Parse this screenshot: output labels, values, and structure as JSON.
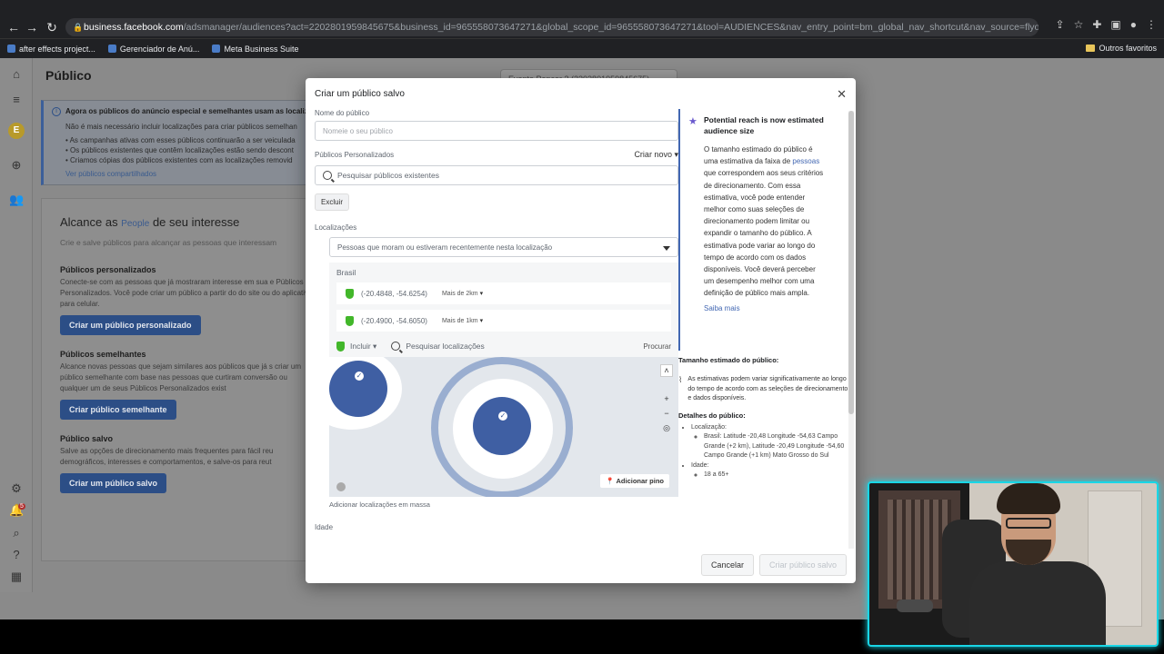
{
  "browser": {
    "url_host": "business.facebook.com",
    "url_rest": "/adsmanager/audiences?act=2202801959845675&business_id=965558073647271&global_scope_id=965558073647271&tool=AUDIENCES&nav_entry_point=bm_global_nav_shortcut&nav_source=flyout_menu&nav_id=2775930...",
    "bookmarks": [
      "after effects project...",
      "Gerenciador de Anú...",
      "Meta Business Suite"
    ],
    "bookmarks_right": "Outros favoritos"
  },
  "page": {
    "title": "Público",
    "account_select": "Evento Popcor 3 (2202801959845675)",
    "notice": {
      "title": "Agora os públicos do anúncio especial e semelhantes usam as localiz",
      "line1": "Não é mais necessário incluir localizações para criar públicos semelhan",
      "bullet1": "• As campanhas ativas com esses públicos continuarão a ser veiculada",
      "bullet2": "• Os públicos existentes que contêm localizações estão sendo descont",
      "bullet3": "• Criamos cópias dos públicos existentes com as localizações removid",
      "link": "Ver públicos compartilhados"
    },
    "card": {
      "heading_a": "Alcance as ",
      "heading_people": "People",
      "heading_b": " de seu interesse",
      "sub": "Crie e salve públicos para alcançar as pessoas que interessam",
      "sections": [
        {
          "title": "Públicos personalizados",
          "text": "Conecte-se com as pessoas que já mostraram interesse em sua e Públicos Personalizados. Você pode criar um público a partir do do site ou do aplicativo para celular.",
          "button": "Criar um público personalizado"
        },
        {
          "title": "Públicos semelhantes",
          "text": "Alcance novas pessoas que sejam similares aos públicos que já s criar um público semelhante com base nas pessoas que curtiram conversão ou qualquer um de seus Públicos Personalizados exist",
          "button": "Criar público semelhante"
        },
        {
          "title": "Público salvo",
          "text": "Salve as opções de direcionamento mais frequentes para fácil reu demográficos, interesses e comportamentos, e salve-os para reut",
          "button": "Criar um público salvo"
        }
      ]
    }
  },
  "modal": {
    "title": "Criar um público salvo",
    "name_label": "Nome do público",
    "name_placeholder": "Nomeie o seu público",
    "custom_label": "Públicos Personalizados",
    "create_new": "Criar novo",
    "search_placeholder": "Pesquisar públicos existentes",
    "exclude_btn": "Excluir",
    "locations_label": "Localizações",
    "locations_dropdown": "Pessoas que moram ou estiveram recentemente nesta localização",
    "country": "Brasil",
    "locations": [
      {
        "coords": "(-20.4848, -54.6254)",
        "radius": "Mais de 2km"
      },
      {
        "coords": "(-20.4900, -54.6050)",
        "radius": "Mais de 1km"
      }
    ],
    "include": "Incluir",
    "search_locations": "Pesquisar localizações",
    "search_btn": "Procurar",
    "add_pin": "Adicionar pino",
    "bulk_link": "Adicionar localizações em massa",
    "age_label": "Idade",
    "cancel": "Cancelar",
    "submit": "Criar público salvo"
  },
  "sidebar_info": {
    "title": "Potential reach is now estimated audience size",
    "text_a": "O tamanho estimado do público é uma estimativa da faixa de ",
    "text_link": "pessoas",
    "text_b": " que correspondem aos seus critérios de direcionamento. Com essa estimativa, você pode entender melhor como suas seleções de direcionamento podem limitar ou expandir o tamanho do público. A estimativa pode variar ao longo do tempo de acordo com os dados disponíveis. Você deverá perceber um desempenho melhor com uma definição de público mais ampla.",
    "learn_more": "Saiba mais",
    "est_title": "Tamanho estimado do público:",
    "est_text": "As estimativas podem variar significativamente ao longo do tempo de acordo com as seleções de direcionamento e dados disponíveis.",
    "details_title": "Detalhes do público:",
    "loc_label": "Localização:",
    "loc_value": "Brasil: Latitude -20,48 Longitude -54,63 Campo Grande (+2 km), Latitude -20,49 Longitude -54,60 Campo Grande (+1 km) Mato Grosso do Sul",
    "age_label": "Idade:",
    "age_value": "18 a 65+"
  },
  "colors": {
    "accent": "#4267b2",
    "cam_border": "#19d6e6",
    "pin_green": "#42b72a"
  }
}
